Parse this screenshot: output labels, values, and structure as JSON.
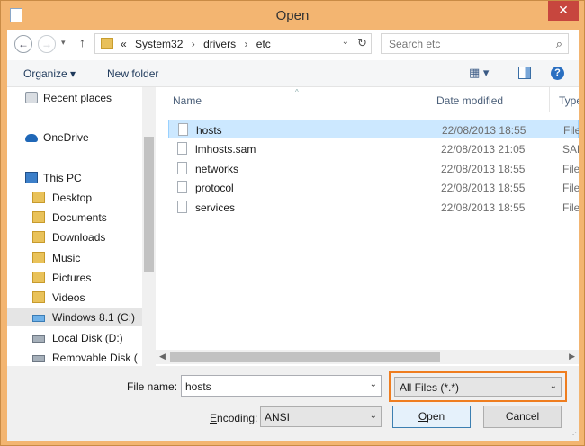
{
  "window": {
    "title": "Open",
    "close_glyph": "✕"
  },
  "address": {
    "overflow": "«",
    "segments": [
      "System32",
      "drivers",
      "etc"
    ],
    "separator": "›",
    "search_placeholder": "Search etc"
  },
  "toolbar": {
    "organize_label": "Organize ▾",
    "new_folder_label": "New folder",
    "help_glyph": "?"
  },
  "nav_pane": {
    "items": [
      {
        "label": "Recent places",
        "icon": "recent-places-icon"
      },
      {
        "label": "OneDrive",
        "icon": "onedrive-icon"
      },
      {
        "label": "This PC",
        "icon": "this-pc-icon"
      },
      {
        "label": "Desktop",
        "icon": "folder-icon"
      },
      {
        "label": "Documents",
        "icon": "folder-icon"
      },
      {
        "label": "Downloads",
        "icon": "folder-icon"
      },
      {
        "label": "Music",
        "icon": "folder-icon"
      },
      {
        "label": "Pictures",
        "icon": "folder-icon"
      },
      {
        "label": "Videos",
        "icon": "folder-icon"
      },
      {
        "label": "Windows 8.1 (C:)",
        "icon": "system-drive-icon"
      },
      {
        "label": "Local Disk (D:)",
        "icon": "drive-icon"
      },
      {
        "label": "Removable Disk (",
        "icon": "removable-drive-icon"
      }
    ]
  },
  "file_list": {
    "columns": {
      "name": "Name",
      "date": "Date modified",
      "type": "Type"
    },
    "rows": [
      {
        "name": "hosts",
        "date": "22/08/2013 18:55",
        "type": "File"
      },
      {
        "name": "lmhosts.sam",
        "date": "22/08/2013 21:05",
        "type": "SAM"
      },
      {
        "name": "networks",
        "date": "22/08/2013 18:55",
        "type": "File"
      },
      {
        "name": "protocol",
        "date": "22/08/2013 18:55",
        "type": "File"
      },
      {
        "name": "services",
        "date": "22/08/2013 18:55",
        "type": "File"
      }
    ]
  },
  "bottom": {
    "file_name_label": "File name:",
    "file_name_value": "hosts",
    "filter_value": "All Files  (*.*)",
    "encoding_label_first": "E",
    "encoding_label_rest": "ncoding:",
    "encoding_value": "ANSI",
    "open_first": "O",
    "open_rest": "pen",
    "cancel_label": "Cancel"
  },
  "colors": {
    "accent": "#ef7d1f",
    "selection": "#cce8ff",
    "frame": "#f3b571"
  }
}
